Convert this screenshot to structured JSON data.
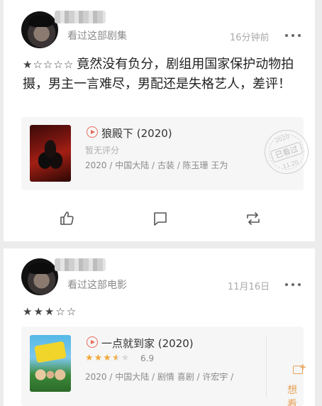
{
  "feed": [
    {
      "id": "card1",
      "action": "看过这部剧集",
      "time": "16分钟前",
      "rating_stars": "★☆☆☆☆",
      "review": "竟然没有负分，剧组用国家保护动物拍摄，男主一言难尽，男配还是失格艺人，差评！",
      "movie": {
        "title": "狼殿下 (2020)",
        "score_text": "暂无评分",
        "info": "2020 / 中国大陆 / 古装 / 陈玉珊 王为"
      },
      "stamp": {
        "year": "2020",
        "label": "已看过",
        "date": "11.20"
      },
      "actions": {
        "like_icon": "thumbs-up-icon",
        "comment_icon": "comment-icon",
        "repost_icon": "repost-icon"
      }
    },
    {
      "id": "card2",
      "action": "看过这部电影",
      "time": "11月16日",
      "rating_stars": "★★★☆☆",
      "movie": {
        "title": "一点就到家 (2020)",
        "stars_filled": "★★★",
        "stars_half": "★",
        "stars_empty": "★",
        "rating_fraction": 0.69,
        "score": "6.9",
        "info": "2020 / 中国大陆 / 剧情 喜剧 / 许宏宇 /"
      },
      "want_label": "想看"
    }
  ],
  "colors": {
    "accent": "#e56b5b",
    "star": "#f2a93b",
    "want": "#e8a35a",
    "background": "#ececec"
  }
}
